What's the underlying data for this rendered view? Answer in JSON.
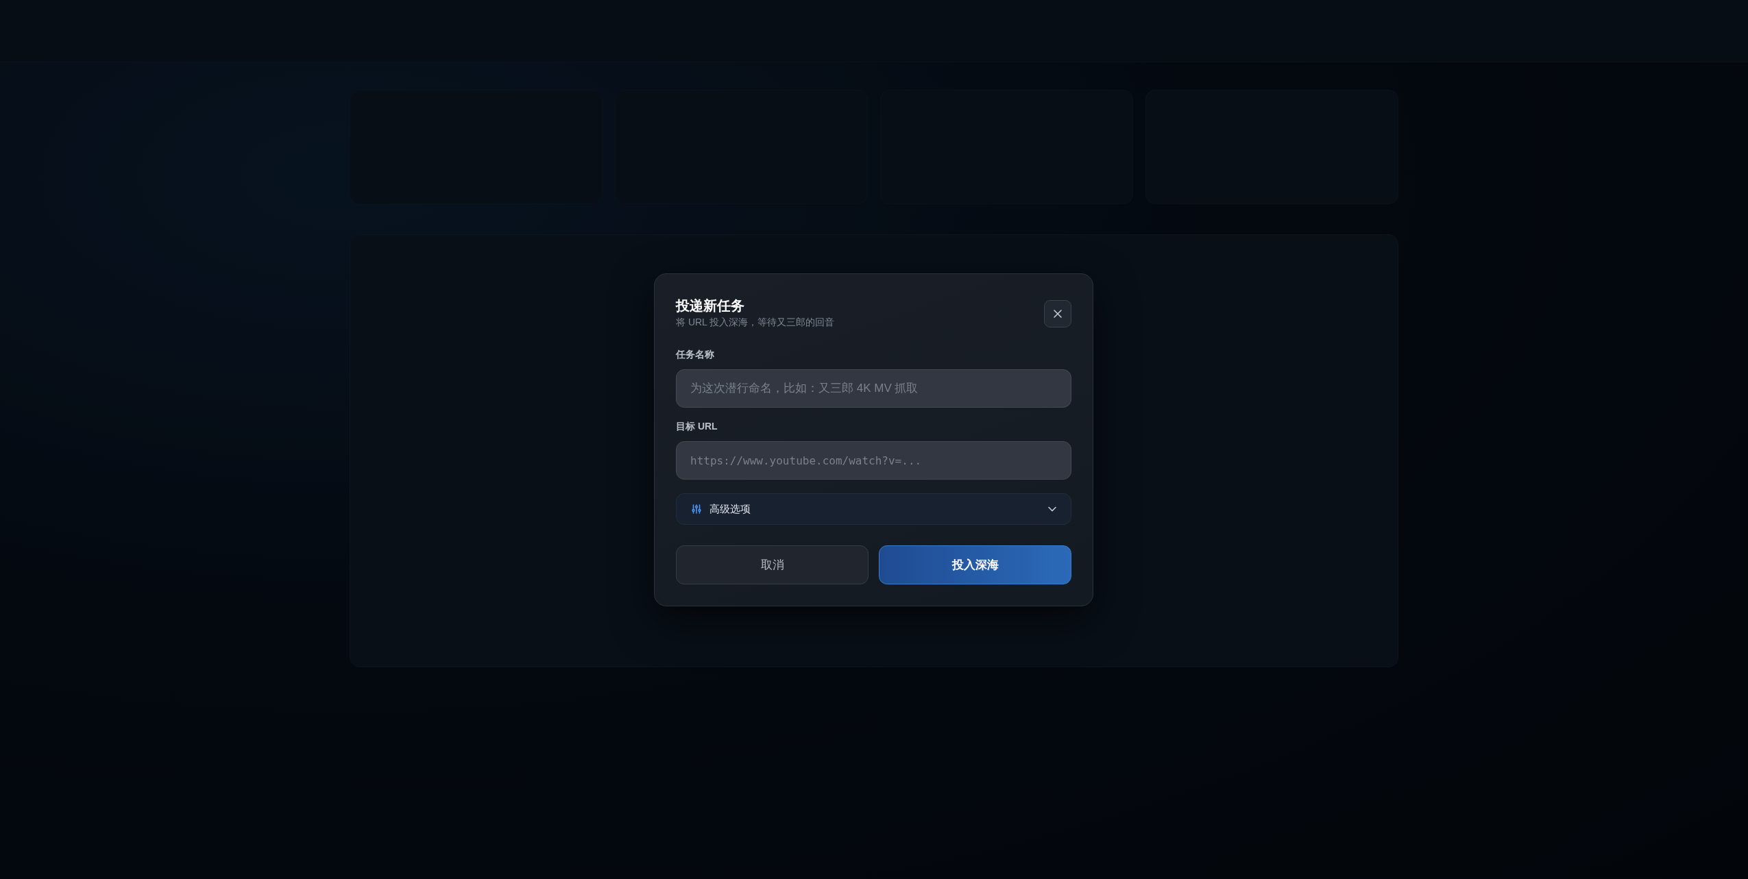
{
  "dialog": {
    "title": "投递新任务",
    "subtitle": "将 URL 投入深海，等待又三郎的回音",
    "fields": [
      {
        "label": "任务名称",
        "placeholder": "为这次潜行命名，比如：又三郎 4K MV 抓取",
        "kind": "text"
      },
      {
        "label": "目标 URL",
        "placeholder": "https://www.youtube.com/watch?v=...",
        "kind": "url"
      }
    ],
    "advanced": {
      "label": "高级选项",
      "expanded": false
    },
    "buttons": [
      {
        "label": "取消",
        "kind": "secondary"
      },
      {
        "label": "投入深海",
        "kind": "primary"
      }
    ]
  }
}
